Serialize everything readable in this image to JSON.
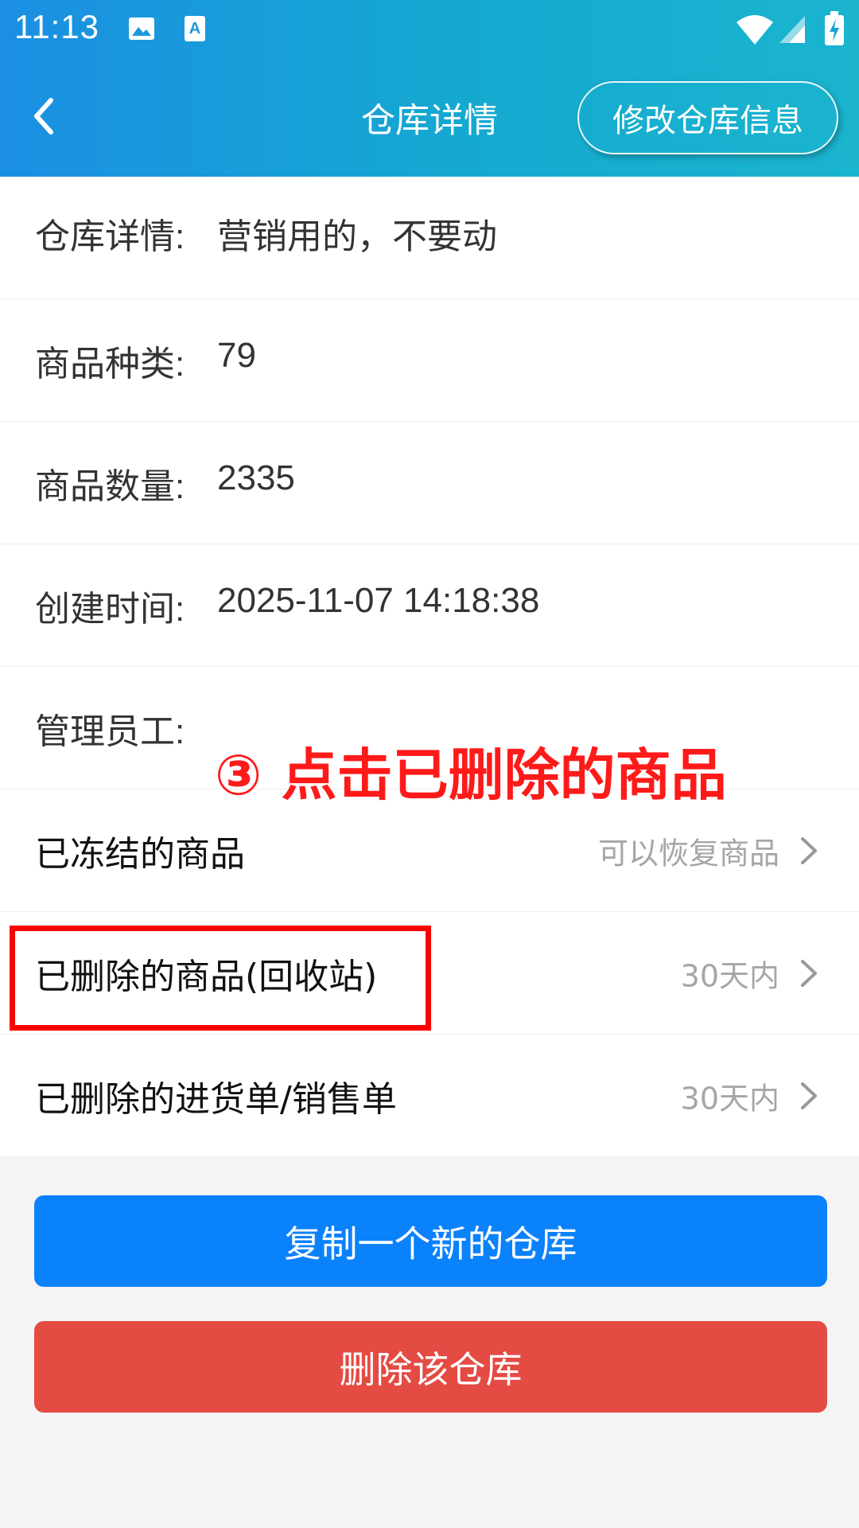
{
  "status_bar": {
    "time": "11:13",
    "icons": [
      "image-icon",
      "text-icon",
      "wifi-icon",
      "signal-icon",
      "battery-charging-icon"
    ]
  },
  "header": {
    "back_icon": "chevron-left-icon",
    "title": "仓库详情",
    "edit_button": "修改仓库信息"
  },
  "info_rows": [
    {
      "label": "仓库详情:",
      "value": "营销用的，不要动"
    },
    {
      "label": "商品种类:",
      "value": "79"
    },
    {
      "label": "商品数量:",
      "value": "2335"
    },
    {
      "label": "创建时间:",
      "value": "2025-11-07 14:18:38"
    },
    {
      "label": "管理员工:",
      "value": ""
    }
  ],
  "nav_rows": [
    {
      "label": "已冻结的商品",
      "hint": "可以恢复商品"
    },
    {
      "label": "已删除的商品(回收站)",
      "hint": "30天内"
    },
    {
      "label": "已删除的进货单/销售单",
      "hint": "30天内"
    }
  ],
  "annotation": {
    "text": "③ 点击已删除的商品",
    "color": "#ff1a1a"
  },
  "buttons": {
    "copy": "复制一个新的仓库",
    "delete": "删除该仓库"
  },
  "colors": {
    "header_start": "#1b8fe3",
    "header_end": "#1ab4cf",
    "primary_button": "#0a82fb",
    "danger_button": "#e34b43",
    "highlight_box": "#ff0000"
  }
}
